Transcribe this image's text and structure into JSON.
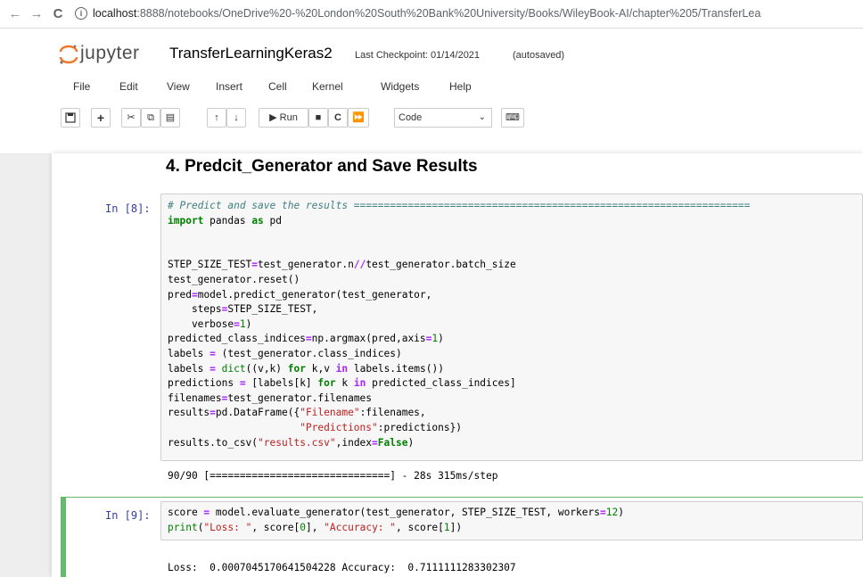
{
  "browser": {
    "back": "←",
    "forward": "→",
    "reload": "C",
    "url_host": "localhost",
    "url_path": ":8888/notebooks/OneDrive%20-%20London%20South%20Bank%20University/Books/WileyBook-AI/chapter%205/TransferLea"
  },
  "jupyter": {
    "logo_text": "jupyter",
    "notebook_title": "TransferLearningKeras2",
    "checkpoint": "Last Checkpoint: 01/14/2021",
    "autosaved": "(autosaved)"
  },
  "menu": [
    "File",
    "Edit",
    "View",
    "Insert",
    "Cell",
    "Kernel",
    "Widgets",
    "Help"
  ],
  "toolbar": {
    "run_label": "Run",
    "cell_type": "Code"
  },
  "heading": "4. Predcit_Generator and Save Results",
  "cell8": {
    "prompt": "In [8]:",
    "output": "90/90 [==============================] - 28s 315ms/step"
  },
  "cell9": {
    "prompt": "In [9]:",
    "output": "Loss:  0.0007045170641504228 Accuracy:  0.7111111283302307"
  },
  "colors": {
    "prompt": "#303f9f",
    "selected_border": "#66bb6a"
  }
}
